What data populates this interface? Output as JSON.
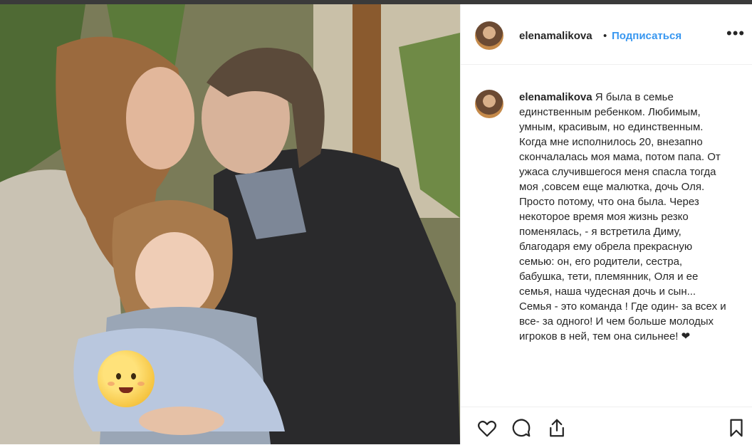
{
  "post": {
    "username": "elenamalikova",
    "separator": "•",
    "follow_label": "Подписаться",
    "more_label": "•••",
    "caption": "Я была в семье единственным ребенком. Любимым, умным, красивым, но единственным. Когда мне исполнилось 20, внезапно скончалалась моя мама, потом папа. От ужаса случившегося меня спасла тогда моя ,совсем еще малютка, дочь Оля. Просто потому, что она была. Через некоторое время моя жизнь резко поменялась, - я встретила Диму, благодаря ему обрела прекрасную семью: он, его родители, сестра, бабушка, тети, племянник, Оля и ее семья, наша чудесная дочь и сын...\nСемья - это команда ! Где один- за всех и все- за одного! И чем больше молодых игроков в ней, тем она сильнее! ❤"
  },
  "icons": {
    "avatar": "profile-photo",
    "like": "heart-icon",
    "comment": "comment-icon",
    "share": "share-icon",
    "save": "bookmark-icon",
    "baby": "baby-emoji"
  },
  "colors": {
    "link": "#3897f0",
    "text": "#262626",
    "border": "#efefef"
  }
}
